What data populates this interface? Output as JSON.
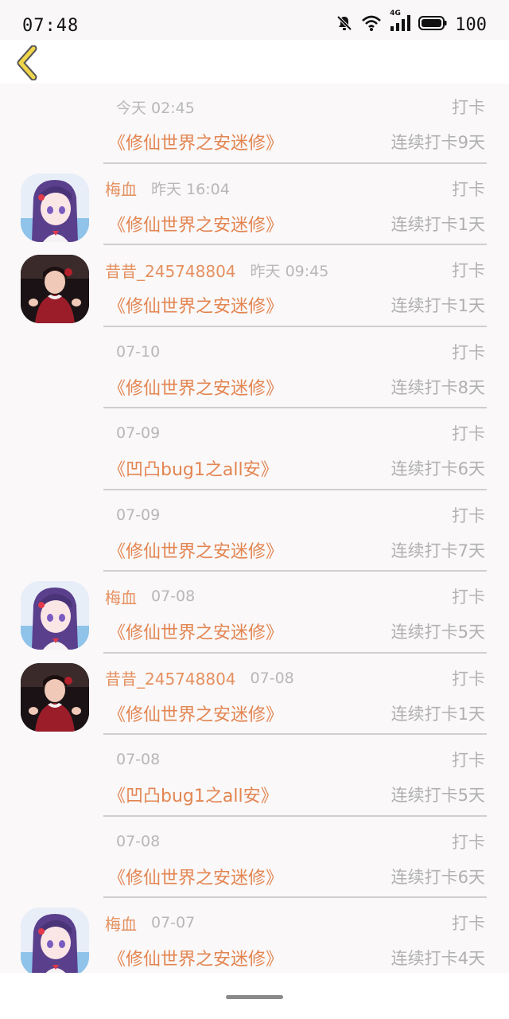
{
  "status": {
    "time": "07:48",
    "battery": "100",
    "network": "4G"
  },
  "colors": {
    "accent": "#e38551",
    "muted": "#b3b3b3",
    "back_arrow": "#f0d54a"
  },
  "items": [
    {
      "avatar": "",
      "name": "",
      "time": "今天 02:45",
      "action": "打卡",
      "book": "《修仙世界之安迷修》",
      "streak": "连续打卡9天"
    },
    {
      "avatar": "girl",
      "name": "梅血",
      "time": "昨天 16:04",
      "action": "打卡",
      "book": "《修仙世界之安迷修》",
      "streak": "连续打卡1天"
    },
    {
      "avatar": "photo",
      "name": "昔昔_245748804",
      "time": "昨天 09:45",
      "action": "打卡",
      "book": "《修仙世界之安迷修》",
      "streak": "连续打卡1天"
    },
    {
      "avatar": "",
      "name": "",
      "time": "07-10",
      "action": "打卡",
      "book": "《修仙世界之安迷修》",
      "streak": "连续打卡8天"
    },
    {
      "avatar": "",
      "name": "",
      "time": "07-09",
      "action": "打卡",
      "book": "《凹凸bug1之all安》",
      "streak": "连续打卡6天"
    },
    {
      "avatar": "",
      "name": "",
      "time": "07-09",
      "action": "打卡",
      "book": "《修仙世界之安迷修》",
      "streak": "连续打卡7天"
    },
    {
      "avatar": "girl",
      "name": "梅血",
      "time": "07-08",
      "action": "打卡",
      "book": "《修仙世界之安迷修》",
      "streak": "连续打卡5天"
    },
    {
      "avatar": "photo",
      "name": "昔昔_245748804",
      "time": "07-08",
      "action": "打卡",
      "book": "《修仙世界之安迷修》",
      "streak": "连续打卡1天"
    },
    {
      "avatar": "",
      "name": "",
      "time": "07-08",
      "action": "打卡",
      "book": "《凹凸bug1之all安》",
      "streak": "连续打卡5天"
    },
    {
      "avatar": "",
      "name": "",
      "time": "07-08",
      "action": "打卡",
      "book": "《修仙世界之安迷修》",
      "streak": "连续打卡6天"
    },
    {
      "avatar": "girl",
      "name": "梅血",
      "time": "07-07",
      "action": "打卡",
      "book": "《修仙世界之安迷修》",
      "streak": "连续打卡4天"
    }
  ]
}
